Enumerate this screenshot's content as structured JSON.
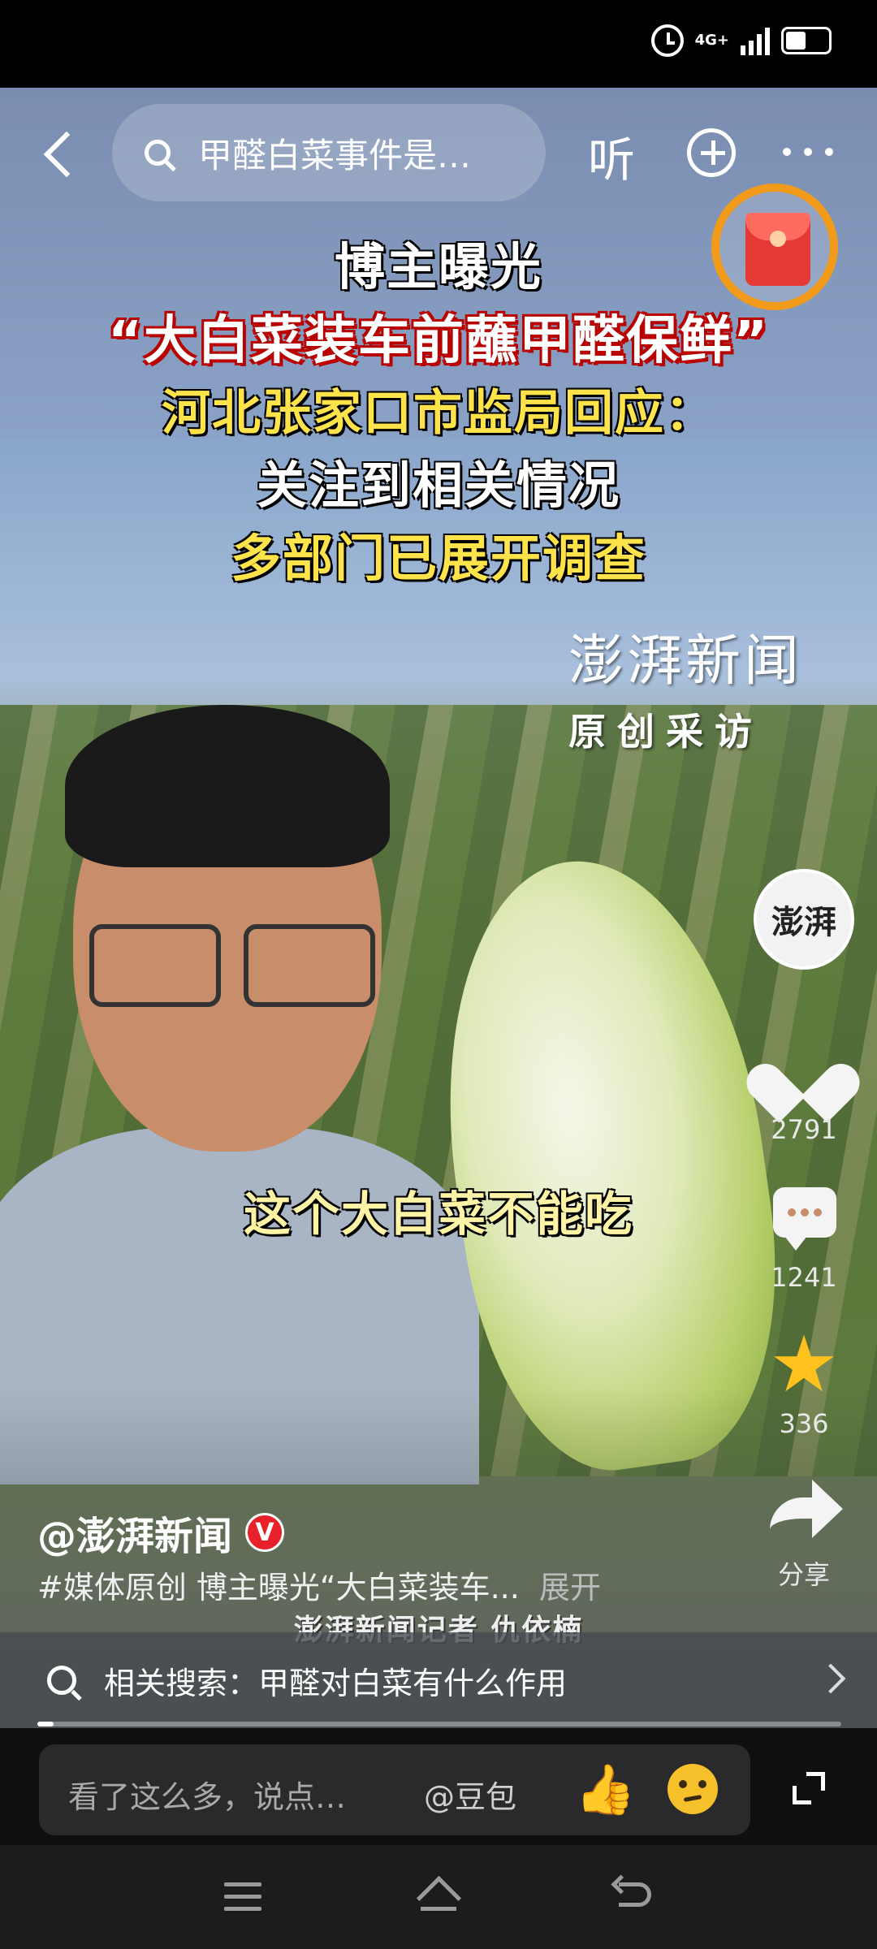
{
  "status": {
    "network": "4G+"
  },
  "header": {
    "search_text": "甲醛白菜事件是…",
    "listen_label": "听"
  },
  "video": {
    "headline": [
      "博主曝光",
      "“大白菜装车前蘸甲醛保鲜”",
      "河北张家口市监局回应：",
      "关注到相关情况",
      "多部门已展开调查"
    ],
    "watermark_name": "澎湃新闻",
    "watermark_sub": "原创采访",
    "caption": "这个大白菜不能吃",
    "reporter": "澎湃新闻记者 仇依楠",
    "progress_fraction": 0.02
  },
  "rail": {
    "avatar_text": "澎湃",
    "likes": "2791",
    "comments": "1241",
    "favorites": "336",
    "share_label": "分享"
  },
  "post": {
    "author": "@澎湃新闻",
    "verified_badge": "V",
    "description": "#媒体原创 博主曝光“大白菜装车...",
    "expand_label": "展开"
  },
  "related": {
    "text": "相关搜索：甲醛对白菜有什么作用"
  },
  "input": {
    "placeholder": "看了这么多，说点…",
    "mention": "@豆包",
    "thumbs": "👍"
  },
  "colors": {
    "verified_red": "#e8202a",
    "star_yellow": "#ffc21c",
    "redpacket_ring": "#f29a1a"
  }
}
